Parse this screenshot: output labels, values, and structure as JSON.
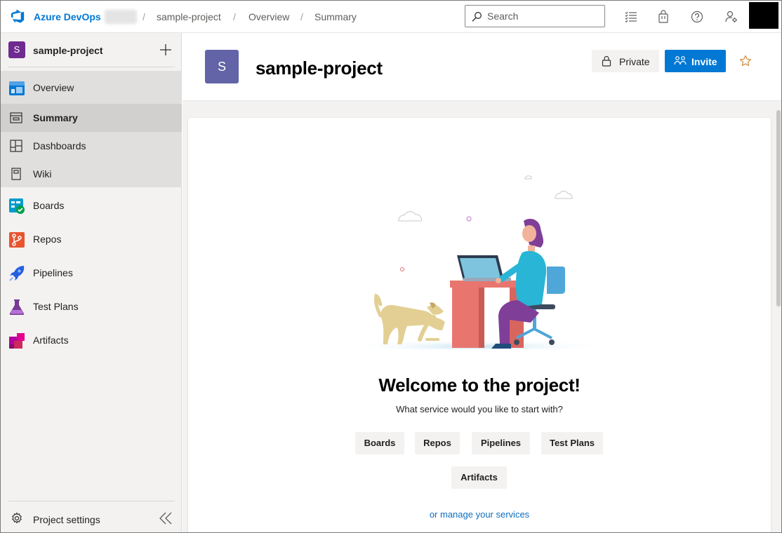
{
  "colors": {
    "accent": "#0078d4",
    "project_tile": "#6f2b8f",
    "header_tile": "#6264a7",
    "star": "#d18a3a"
  },
  "topbar": {
    "brand": "Azure DevOps",
    "breadcrumbs": [
      "sample-project",
      "Overview",
      "Summary"
    ],
    "breadcrumb_separator": "/",
    "search_placeholder": "Search",
    "icons": [
      "work-items-icon",
      "marketplace-bag-icon",
      "help-icon",
      "user-settings-icon"
    ]
  },
  "sidebar": {
    "project_initial": "S",
    "project_name": "sample-project",
    "items": [
      {
        "label": "Overview",
        "icon": "overview-icon"
      },
      {
        "label": "Summary",
        "icon": "summary-icon"
      },
      {
        "label": "Dashboards",
        "icon": "dashboards-icon"
      },
      {
        "label": "Wiki",
        "icon": "wiki-icon"
      },
      {
        "label": "Boards",
        "icon": "boards-icon"
      },
      {
        "label": "Repos",
        "icon": "repos-icon"
      },
      {
        "label": "Pipelines",
        "icon": "pipelines-icon"
      },
      {
        "label": "Test Plans",
        "icon": "test-plans-icon"
      },
      {
        "label": "Artifacts",
        "icon": "artifacts-icon"
      }
    ],
    "settings_label": "Project settings"
  },
  "header": {
    "project_initial": "S",
    "title": "sample-project",
    "private_label": "Private",
    "invite_label": "Invite"
  },
  "welcome": {
    "title": "Welcome to the project!",
    "subtitle": "What service would you like to start with?",
    "services": [
      "Boards",
      "Repos",
      "Pipelines",
      "Test Plans",
      "Artifacts"
    ],
    "manage_link": "or manage your services"
  }
}
